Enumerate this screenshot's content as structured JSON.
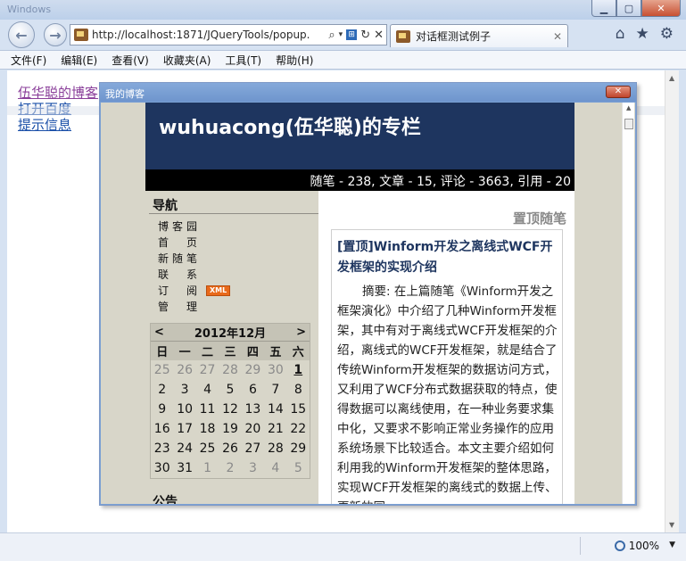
{
  "browser": {
    "window_title": "Windows",
    "address_url": "http://localhost:1871/JQueryTools/popup.",
    "tab_label": "对话框测试例子",
    "menus": [
      "文件(F)",
      "编辑(E)",
      "查看(V)",
      "收藏夹(A)",
      "工具(T)",
      "帮助(H)"
    ],
    "zoom": "100%"
  },
  "page": {
    "links": [
      "伍华聪的博客",
      "打开百度",
      "提示信息"
    ]
  },
  "dialog": {
    "title": "我的博客",
    "blog": {
      "title": "wuhuacong(伍华聪)的专栏",
      "stats": "随笔 - 238, 文章 - 15, 评论 - 3663, 引用 - 20",
      "nav_heading": "导航",
      "nav_items": [
        "博客园",
        "首　页",
        "新随笔",
        "联　系",
        "订　阅",
        "管　理"
      ],
      "xml_badge": "XML",
      "calendar": {
        "prev": "<",
        "next": ">",
        "month": "2012年12月",
        "weekdays": [
          "日",
          "一",
          "二",
          "三",
          "四",
          "五",
          "六"
        ],
        "weeks": [
          [
            "25",
            "26",
            "27",
            "28",
            "29",
            "30",
            "1"
          ],
          [
            "2",
            "3",
            "4",
            "5",
            "6",
            "7",
            "8"
          ],
          [
            "9",
            "10",
            "11",
            "12",
            "13",
            "14",
            "15"
          ],
          [
            "16",
            "17",
            "18",
            "19",
            "20",
            "21",
            "22"
          ],
          [
            "23",
            "24",
            "25",
            "26",
            "27",
            "28",
            "29"
          ],
          [
            "30",
            "31",
            "1",
            "2",
            "3",
            "4",
            "5"
          ]
        ]
      },
      "notice_heading": "公告",
      "pinned_label": "置顶随笔",
      "post_title": "[置顶]Winform开发之离线式WCF开发框架的实现介绍",
      "post_summary": "摘要: 在上篇随笔《Winform开发之框架演化》中介绍了几种Winform开发框架，其中有对于离线式WCF开发框架的介绍，离线式的WCF开发框架，就是结合了传统Winform开发框架的数据访问方式，又利用了WCF分布式数据获取的特点，使得数据可以离线使用，在一种业务要求集中化，又要求不影响正常业务操作的应用系统场景下比较适合。本文主要介绍如何利用我的Winform开发框架的整体思路，实现WCF开发框架的离线式的数据上传、更新的同"
    }
  }
}
